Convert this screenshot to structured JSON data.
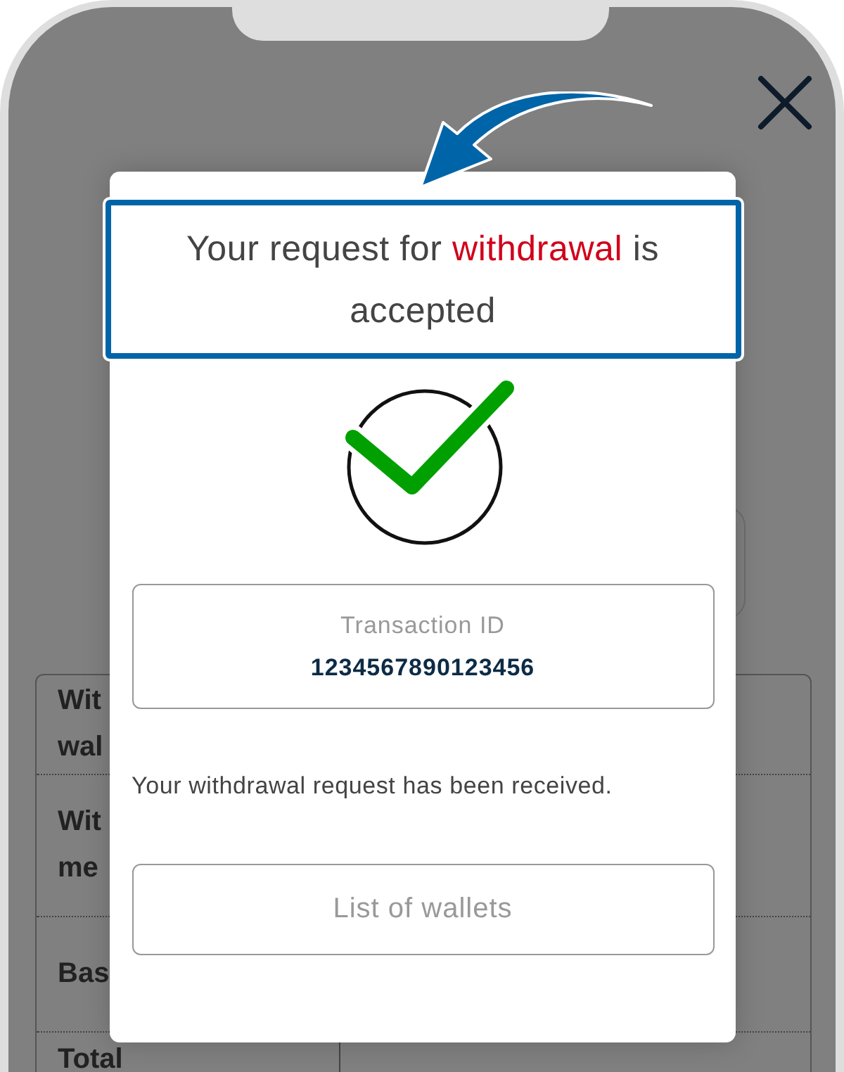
{
  "background_table": {
    "rows": [
      {
        "label_lines": [
          "Wit",
          "wal"
        ]
      },
      {
        "label_lines": [
          "Wit",
          "me"
        ]
      },
      {
        "label_lines": [
          "Bas"
        ]
      },
      {
        "label_lines": [
          "Total"
        ]
      }
    ]
  },
  "dialog": {
    "title": {
      "before": "Your request for",
      "highlight": "withdrawal",
      "after": "is accepted"
    },
    "transaction": {
      "label": "Transaction ID",
      "value": "1234567890123456"
    },
    "message": "Your withdrawal request has been received.",
    "button": "List of wallets"
  }
}
